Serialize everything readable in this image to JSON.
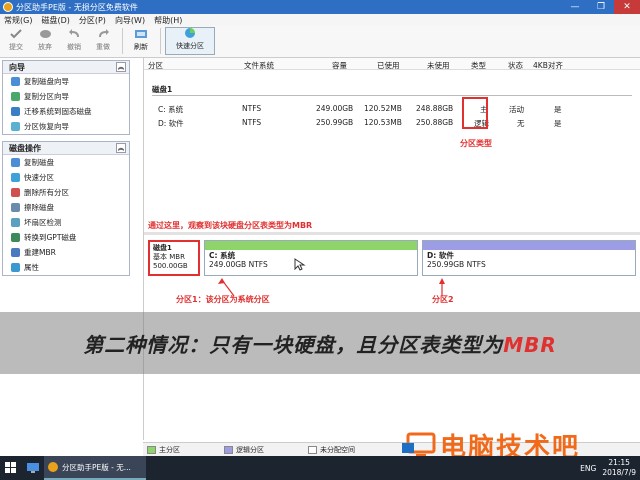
{
  "window": {
    "title": "分区助手PE版 - 无损分区免费软件",
    "min": "—",
    "restore": "❐",
    "close": "✕"
  },
  "menu": [
    "常规(G)",
    "磁盘(D)",
    "分区(P)",
    "向导(W)",
    "帮助(H)"
  ],
  "toolbar": {
    "items": [
      "提交",
      "放弃",
      "撤销",
      "重做",
      "刷新"
    ],
    "quick": "快速分区"
  },
  "sidebar": {
    "wizard": {
      "title": "向导",
      "items": [
        "复制磁盘向导",
        "复制分区向导",
        "迁移系统到固态磁盘",
        "分区恢复向导"
      ]
    },
    "disk_ops": {
      "title": "磁盘操作",
      "items": [
        "复制磁盘",
        "快速分区",
        "删除所有分区",
        "擦除磁盘",
        "坏扇区检测",
        "转换到GPT磁盘",
        "重建MBR",
        "属性"
      ]
    }
  },
  "table": {
    "headers": [
      "分区",
      "文件系统",
      "容量",
      "已使用",
      "未使用",
      "类型",
      "状态",
      "4KB对齐"
    ],
    "disk_label": "磁盘1",
    "rows": [
      {
        "name": "C: 系统",
        "fs": "NTFS",
        "cap": "249.00GB",
        "used": "120.52MB",
        "free": "248.88GB",
        "type": "主",
        "status": "活动",
        "align": "是"
      },
      {
        "name": "D: 软件",
        "fs": "NTFS",
        "cap": "250.99GB",
        "used": "120.53MB",
        "free": "250.88GB",
        "type": "逻辑",
        "status": "无",
        "align": "是"
      }
    ]
  },
  "annotations": {
    "type_label": "分区类型",
    "mbr_hint": "通过这里，观察到该块硬盘分区表类型为MBR",
    "part1": "分区1：该分区为系统分区",
    "part2": "分区2"
  },
  "diskmap": {
    "disk": {
      "name": "磁盘1",
      "kind": "基本 MBR",
      "size": "500.00GB"
    },
    "parts": [
      {
        "name": "C: 系统",
        "info": "249.00GB NTFS",
        "color": "#8fd46a"
      },
      {
        "name": "D: 软件",
        "info": "250.99GB NTFS",
        "color": "#9d9de6"
      }
    ]
  },
  "overlay": {
    "text": "第二种情况：只有一块硬盘，且分区表类型为",
    "highlight": "MBR"
  },
  "legend": [
    "主分区",
    "逻辑分区",
    "未分配空间"
  ],
  "watermark": "电脑技术吧",
  "taskbar": {
    "active": "分区助手PE版 - 无...",
    "lang": "ENG",
    "time": "21:15",
    "date": "2018/7/9"
  },
  "colors": {
    "titlebar": "#2e6fc4",
    "accent_red": "#e03030",
    "primary_green": "#8fd46a",
    "logical_purple": "#9d9de6"
  }
}
